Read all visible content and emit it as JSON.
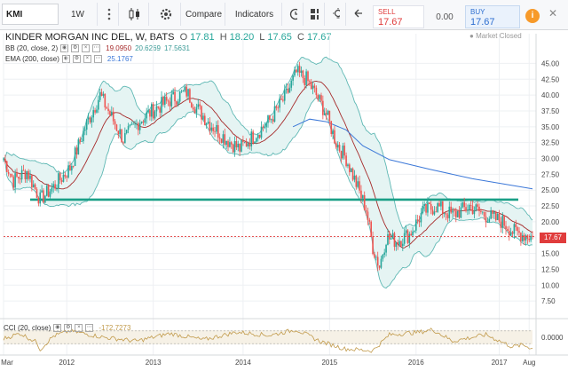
{
  "toolbar": {
    "symbol": "KMI",
    "interval": "1W",
    "compare_label": "Compare",
    "indicators_label": "Indicators"
  },
  "trade": {
    "sell_label": "SELL",
    "sell_price": "17.67",
    "spread": "0.00",
    "buy_label": "BUY",
    "buy_price": "17.67"
  },
  "chart_header": {
    "title": "KINDER MORGAN INC DEL, W, BATS",
    "o_label": "O",
    "o_value": "17.81",
    "h_label": "H",
    "h_value": "18.20",
    "l_label": "L",
    "l_value": "17.65",
    "c_label": "C",
    "c_value": "17.67",
    "bb_label": "BB (20, close, 2)",
    "bb_values": [
      "19.0950",
      "20.6269",
      "17.5631"
    ],
    "ema_label": "EMA (200, close)",
    "ema_value": "25.1767",
    "market_status": "Market Closed",
    "last_price": "17.67"
  },
  "cci": {
    "label": "CCI (20, close)",
    "value": "-172.7273",
    "axis_label": "0.0000"
  },
  "colors": {
    "up": "#26a69a",
    "down": "#ef5350",
    "bb_line": "#5fb8b4",
    "bb_fill": "#e5f4f3",
    "basis": "#a62b2b",
    "ema": "#3c78d8",
    "support": "#1a9f87",
    "cci_line": "#c19a4b"
  },
  "chart_data": {
    "type": "candlestick",
    "title": "KINDER MORGAN INC DEL, W, BATS",
    "x_ticks": [
      "Mar",
      "2012",
      "2013",
      "2014",
      "2015",
      "2016",
      "2017",
      "Aug"
    ],
    "y_ticks": [
      "45.00",
      "42.50",
      "40.00",
      "37.50",
      "35.00",
      "32.50",
      "30.00",
      "27.50",
      "25.00",
      "22.50",
      "20.00",
      "17.50",
      "15.00",
      "12.50",
      "10.00",
      "7.50"
    ],
    "ylim": [
      5.0,
      48.0
    ],
    "support_level": 23.5,
    "last_price": 17.67,
    "price_path": [
      [
        0,
        30.0
      ],
      [
        6,
        26.5
      ],
      [
        14,
        28.0
      ],
      [
        22,
        23.5
      ],
      [
        30,
        25.5
      ],
      [
        40,
        28.5
      ],
      [
        50,
        35.5
      ],
      [
        58,
        40.0
      ],
      [
        64,
        37.0
      ],
      [
        72,
        33.0
      ],
      [
        82,
        36.0
      ],
      [
        92,
        38.0
      ],
      [
        102,
        39.5
      ],
      [
        110,
        40.5
      ],
      [
        116,
        38.0
      ],
      [
        124,
        35.5
      ],
      [
        134,
        33.0
      ],
      [
        142,
        31.5
      ],
      [
        150,
        33.5
      ],
      [
        160,
        36.0
      ],
      [
        170,
        40.0
      ],
      [
        176,
        43.5
      ],
      [
        182,
        42.5
      ],
      [
        188,
        40.0
      ],
      [
        194,
        37.0
      ],
      [
        200,
        32.5
      ],
      [
        206,
        30.0
      ],
      [
        212,
        26.0
      ],
      [
        218,
        22.0
      ],
      [
        222,
        16.0
      ],
      [
        226,
        13.0
      ],
      [
        230,
        17.5
      ],
      [
        236,
        17.0
      ],
      [
        244,
        18.0
      ],
      [
        252,
        21.5
      ],
      [
        260,
        22.5
      ],
      [
        270,
        21.0
      ],
      [
        280,
        22.5
      ],
      [
        290,
        21.0
      ],
      [
        300,
        20.0
      ],
      [
        306,
        18.5
      ],
      [
        312,
        18.0
      ],
      [
        318,
        17.67
      ]
    ],
    "ema_path": [
      [
        174,
        35.0
      ],
      [
        184,
        36.2
      ],
      [
        194,
        35.8
      ],
      [
        206,
        34.5
      ],
      [
        216,
        32.0
      ],
      [
        232,
        29.8
      ],
      [
        256,
        28.3
      ],
      [
        282,
        26.8
      ],
      [
        318,
        25.2
      ]
    ],
    "cci_path": [
      [
        0,
        -20
      ],
      [
        10,
        60
      ],
      [
        20,
        -80
      ],
      [
        22,
        -190
      ],
      [
        30,
        20
      ],
      [
        40,
        100
      ],
      [
        60,
        0
      ],
      [
        80,
        -60
      ],
      [
        100,
        60
      ],
      [
        120,
        -40
      ],
      [
        140,
        80
      ],
      [
        160,
        30
      ],
      [
        176,
        120
      ],
      [
        190,
        -60
      ],
      [
        205,
        -180
      ],
      [
        222,
        -210
      ],
      [
        232,
        40
      ],
      [
        250,
        80
      ],
      [
        258,
        120
      ],
      [
        270,
        -60
      ],
      [
        290,
        40
      ],
      [
        306,
        -150
      ],
      [
        312,
        -120
      ],
      [
        318,
        -172.7
      ]
    ],
    "cci_ylim": [
      -250,
      250
    ]
  }
}
